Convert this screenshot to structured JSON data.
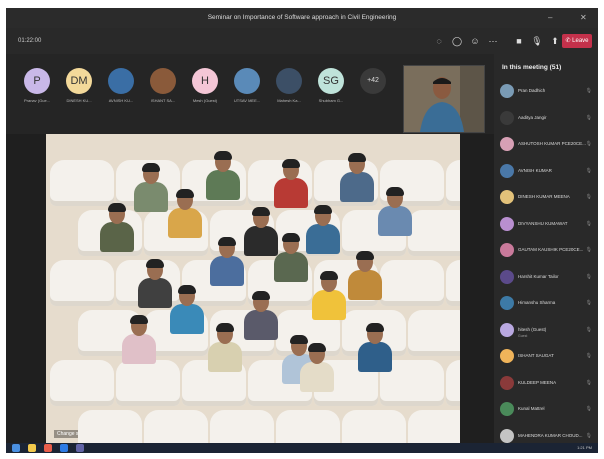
{
  "window": {
    "title": "Seminar on Importance of Software approach in Civil Engineering"
  },
  "meeting": {
    "timer": "01:22:00",
    "leave_label": "Leave"
  },
  "strip": {
    "participants": [
      {
        "initials": "P",
        "name": "Pranav (Gue...",
        "color": "#c9b8e8"
      },
      {
        "initials": "DM",
        "name": "DINESH KU...",
        "color": "#f3d99a"
      },
      {
        "initials": "",
        "name": "AVNISH KU...",
        "color": "#3a6ea5"
      },
      {
        "initials": "",
        "name": "ISHANT SA...",
        "color": "#8a5a3a"
      },
      {
        "initials": "H",
        "name": "Mesh (Guest)",
        "color": "#f4c6d6"
      },
      {
        "initials": "",
        "name": "UTSAV MEE...",
        "color": "#5a8ab8"
      },
      {
        "initials": "",
        "name": "Mahesh Ka...",
        "color": "#3c4f66"
      },
      {
        "initials": "SG",
        "name": "Shubham G...",
        "color": "#bfe3da"
      },
      {
        "initials": "+42",
        "name": "",
        "color": "#3a3a3a"
      }
    ]
  },
  "stage": {
    "change_scene": "Change scene"
  },
  "panel": {
    "title": "In this meeting (51)",
    "people": [
      {
        "name": "Pran Dadhich",
        "sub": "",
        "color": "#7a9bb5"
      },
      {
        "name": "Aaditya Jangir",
        "sub": "",
        "color": "#3a3a3a"
      },
      {
        "name": "ASHUTOSH KUMAR PCE20CE...",
        "sub": "",
        "color": "#d7a0b5"
      },
      {
        "name": "AVNISH KUMAR",
        "sub": "",
        "color": "#4a78a8"
      },
      {
        "name": "DINESH KUMAR MEENA",
        "sub": "",
        "color": "#e3c27a"
      },
      {
        "name": "DIVYANSHU KUMAWAT",
        "sub": "",
        "color": "#b98fd0"
      },
      {
        "name": "GAUTAM KAUSHIK PCE20CE...",
        "sub": "",
        "color": "#c97a9b"
      },
      {
        "name": "Harshit Kumar Tailor",
        "sub": "",
        "color": "#5b4a8a"
      },
      {
        "name": "Himanshu Sharma",
        "sub": "",
        "color": "#3d7aa6"
      },
      {
        "name": "hitesh (Guest)",
        "sub": "Guest",
        "color": "#b9a8e0"
      },
      {
        "name": "ISHANT SAUGAT",
        "sub": "",
        "color": "#f0b45a"
      },
      {
        "name": "KULDEEP MEENA",
        "sub": "",
        "color": "#8a3a3a"
      },
      {
        "name": "Kunal Mattrel",
        "sub": "",
        "color": "#4a8a5a"
      },
      {
        "name": "MAHENDRA KUMAR CHOUD...",
        "sub": "",
        "color": "#c4c4c4"
      }
    ]
  },
  "taskbar": {
    "clock": "1:21 PM"
  }
}
